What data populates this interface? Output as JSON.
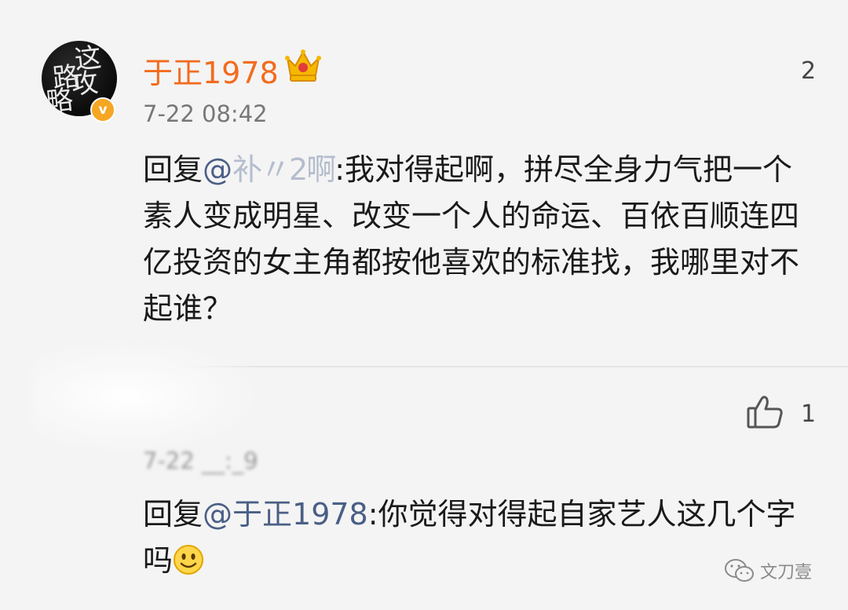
{
  "comment1": {
    "username": "于正1978",
    "avatar_text": [
      "这",
      "路",
      "攻",
      "略"
    ],
    "verified_badge": "v",
    "count": "2",
    "timestamp": "7-22 08:42",
    "reply_prefix": "回复",
    "mention": "@",
    "mention_smudged": "补〃2啊",
    "text": ":我对得起啊，拼尽全身力气把一个素人变成明星、改变一个人的命运、百依百顺连四亿投资的女主角都按他喜欢的标准找，我哪里对不起谁？"
  },
  "comment2": {
    "timestamp_partial": "7-22 __:_9",
    "like_count": "1",
    "reply_prefix": "回复",
    "mention": "@于正1978",
    "text": ":你觉得对得起自家艺人这几个字吗"
  },
  "watermark": {
    "text": "文刀壹"
  },
  "colors": {
    "username": "#f26c1e",
    "mention": "#4a5f86",
    "badge": "#f5a623"
  }
}
